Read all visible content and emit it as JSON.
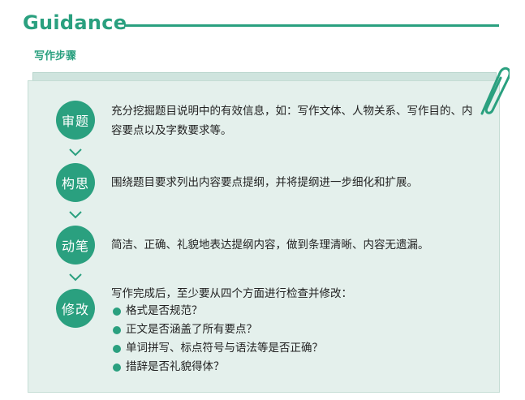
{
  "header": {
    "title": "Guidance"
  },
  "subtitle": "写作步骤",
  "steps": [
    {
      "label": "审题",
      "text": "充分挖掘题目说明中的有效信息，如：写作文体、人物关系、写作目的、内容要点以及字数要求等。"
    },
    {
      "label": "构思",
      "text": "围绕题目要求列出内容要点提纲，并将提纲进一步细化和扩展。"
    },
    {
      "label": "动笔",
      "text": "简洁、正确、礼貌地表达提纲内容，做到条理清晰、内容无遗漏。"
    },
    {
      "label": "修改",
      "text": "写作完成后，至少要从四个方面进行检查并修改："
    }
  ],
  "checklist": [
    "格式是否规范？",
    "正文是否涵盖了所有要点？",
    "单词拼写、标点符号与语法等是否正确？",
    "措辞是否礼貌得体？"
  ],
  "colors": {
    "accent": "#2aa07f",
    "panel": "#e4f0ec",
    "panel_back": "#cfe4de"
  },
  "icons": {
    "clip": "paperclip-icon",
    "arrow": "chevron-down-icon",
    "bullet": "bullet-dot"
  }
}
